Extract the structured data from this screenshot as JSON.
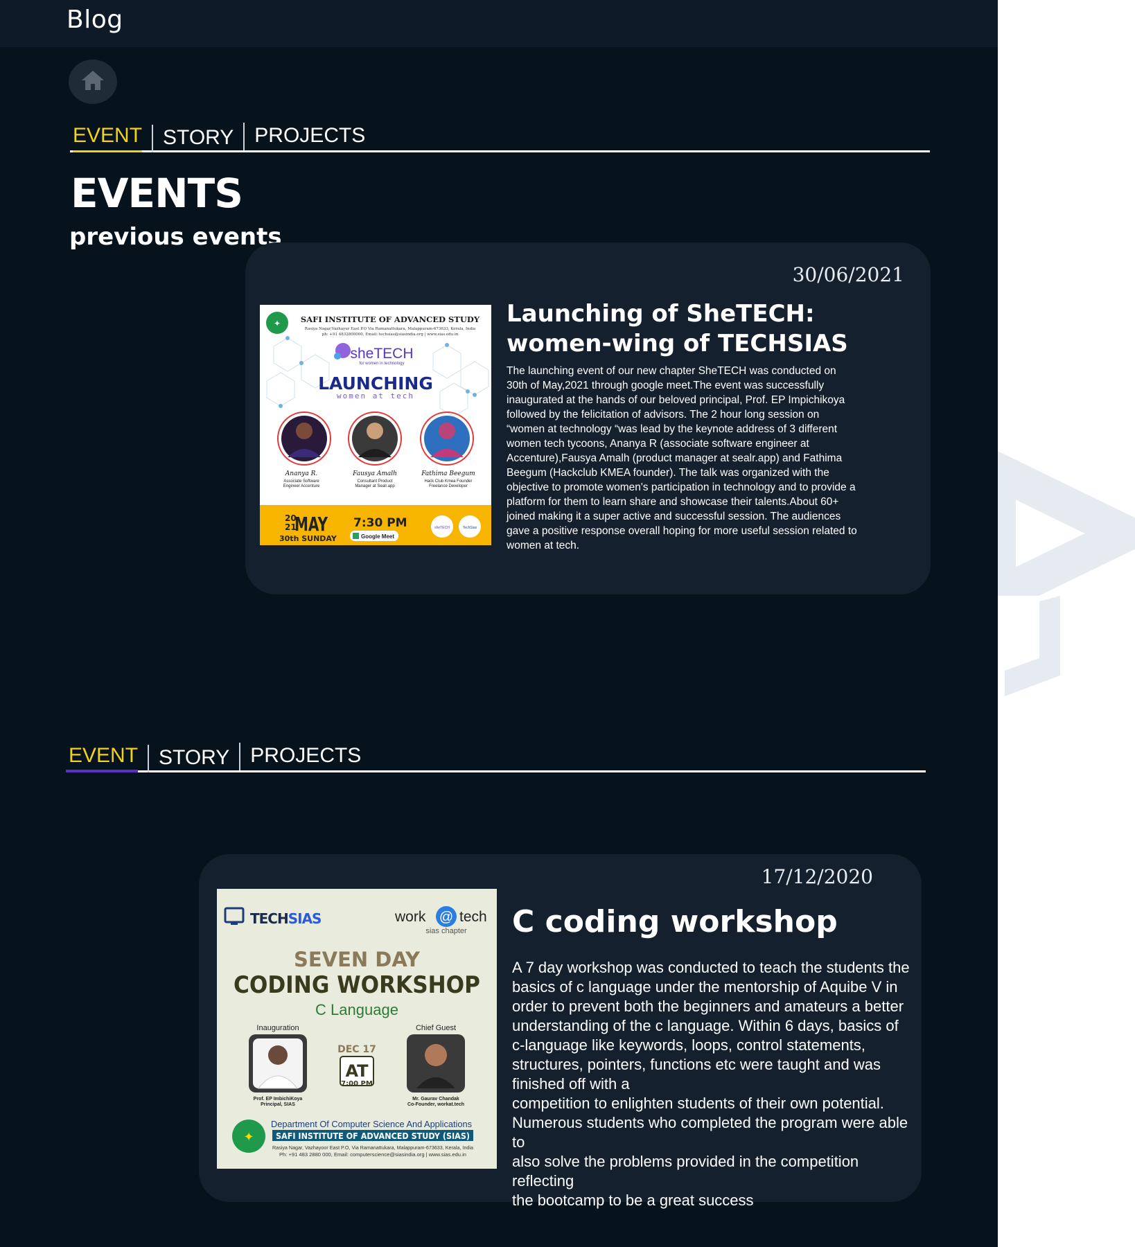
{
  "app": {
    "title": "Blog"
  },
  "icons": {
    "home": "home-icon"
  },
  "tabs": {
    "event": "EVENT",
    "story": "STORY",
    "projects": "PROJECTS"
  },
  "events_header": {
    "title": "EVENTS",
    "subtitle": "previous events"
  },
  "colors": {
    "background": "#06131d",
    "card": "#15202e",
    "active_tab": "#f2d21a",
    "accent_purple": "#5a2fc4"
  },
  "events": [
    {
      "date": "30/06/2021",
      "title_line1": "Launching of SheTECH:",
      "title_line2": "women-wing of TECHSIAS",
      "description": "The launching event of our new chapter SheTECH was conducted on 30th of May,2021 through google meet.The event was successfully inaugurated at the hands of our beloved principal, Prof. EP Impichikoya followed by the felicitation of advisors. The  2 hour long session on “women at technology “was lead by the keynote address of 3 different women tech tycoons, Ananya R  (associate software engineer at Accenture),Fausya Amalh (product manager at sealr.app) and Fathima Beegum (Hackclub KMEA founder). The talk was organized with the objective to promote women's participation in technology and to provide a platform for them to learn share and showcase their talents.About 60+ joined making it a super active and successful session. The audiences gave a positive response overall hoping for more useful session related to women at tech.",
      "poster": {
        "institute": "SAFI INSTITUTE OF ADVANCED STUDY",
        "address": "Rasiya Nagar,Vazhayur East P.O Via Ramanattukara, Malappuram-673633, Kerala, India",
        "contact": "ph: +91 4832800000, Email: techsias@siasindia.org | www.sias.edu.in",
        "brand": "sheTECH",
        "brand_sub": "for women in technology",
        "headline": "LAUNCHING",
        "tagline": "women at tech",
        "speakers": [
          {
            "name": "Ananya R.",
            "role1": "Associate Software",
            "role2": "Engineer Accenture"
          },
          {
            "name": "Fausya Amalh",
            "role1": "Consultant Product",
            "role2": "Manager at Sealr.app"
          },
          {
            "name": "Fathima Beegum",
            "role1": "Hack Club Kmea Founder",
            "role2": "Freelance Developer"
          }
        ],
        "year_top": "20",
        "year_bottom": "21",
        "month": "MAY",
        "day": "30th SUNDAY",
        "time": "7:30 PM",
        "platform": "Google Meet",
        "logo1": "sheTECH",
        "logo2": "TechSias"
      }
    },
    {
      "date": "17/12/2020",
      "title_line1": "C coding workshop",
      "description_lines": [
        "A 7 day workshop was conducted to teach the students the",
        "basics of c language under the mentorship of Aquibe V in",
        "order to prevent both the beginners and amateurs a better",
        "understanding of the c language. Within 6 days, basics of",
        "c-language like keywords, loops, control statements,",
        "structures, pointers, functions etc were taught and was",
        "finished off with a",
        "competition to enlighten students of their own potential.",
        "Numerous students who completed the program were able to",
        "also solve the problems provided in the competition reflecting",
        "the bootcamp to be a great success"
      ],
      "poster": {
        "brand_a": "TECH",
        "brand_b": "SIAS",
        "partner_a": "work",
        "partner_at": "@",
        "partner_b": "tech",
        "partner_sub": "sias chapter",
        "line1": "SEVEN DAY",
        "line2": "CODING WORKSHOP",
        "line3": "C Language",
        "inauguration": "Inauguration",
        "chief_guest": "Chief Guest",
        "date": "DEC 17",
        "at": "AT",
        "time": "7:00 PM",
        "person1_name": "Prof. EP ImbichiKoya",
        "person1_role": "Principal, SIAS",
        "person2_name": "Mr. Gaurav Chandak",
        "person2_role": "Co-Founder, workat.tech",
        "dept": "Department Of Computer Science And Applications",
        "institute": "SAFI INSTITUTE OF ADVANCED STUDY (SIAS)",
        "address": "Rasiya Nagar, Vazhayoor East P.O, Via Ramanattukara, Malappuram-673633, Kerala, India",
        "contact": "Ph: +91 483 2880 000, Email: computerscience@siasindia.org | www.sias.edu.in"
      }
    }
  ]
}
